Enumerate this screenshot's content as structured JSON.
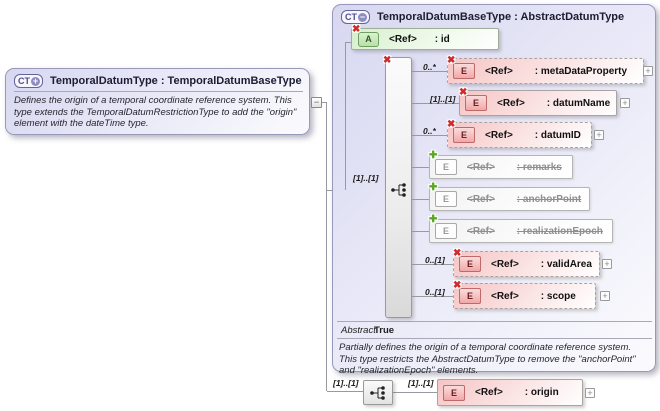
{
  "icons": {
    "ct": "CT",
    "expand": "+",
    "collapse": "−",
    "removed_x": "✖",
    "added_plus": "✚",
    "attribute_letter": "A",
    "element_letter": "E"
  },
  "left_box": {
    "title": "TemporalDatumType : TemporalDatumBaseType",
    "description": "Defines the origin of a temporal coordinate reference system. This type extends the TemporalDatumRestrictionType to add the \"origin\" element with the dateTime type."
  },
  "right_box": {
    "title": "TemporalDatumBaseType : AbstractDatumType",
    "attribute": {
      "ref": "<Ref>",
      "name": ": id"
    },
    "group_occurrence": "[1]..[1]",
    "elements": [
      {
        "occurrence": "0..*",
        "ref": "<Ref>",
        "name": ": metaDataProperty"
      },
      {
        "occurrence": "[1]..[1]",
        "ref": "<Ref>",
        "name": ": datumName"
      },
      {
        "occurrence": "0..*",
        "ref": "<Ref>",
        "name": ": datumID"
      },
      {
        "occurrence": "",
        "ref": "<Ref>",
        "name": ": remarks"
      },
      {
        "occurrence": "",
        "ref": "<Ref>",
        "name": ": anchorPoint"
      },
      {
        "occurrence": "",
        "ref": "<Ref>",
        "name": ": realizationEpoch"
      },
      {
        "occurrence": "0..[1]",
        "ref": "<Ref>",
        "name": ": validArea"
      },
      {
        "occurrence": "0..[1]",
        "ref": "<Ref>",
        "name": ": scope"
      }
    ],
    "abstract": {
      "label": "Abstract",
      "value": "True"
    },
    "description": "Partially defines the origin of a temporal coordinate reference system. This type restricts the AbstractDatumType to remove the \"anchorPoint\" and \"realizationEpoch\" elements."
  },
  "bottom_row": {
    "outer_occurrence": "[1]..[1]",
    "inner_occurrence": "[1]..[1]",
    "element": {
      "ref": "<Ref>",
      "name": ": origin"
    }
  }
}
